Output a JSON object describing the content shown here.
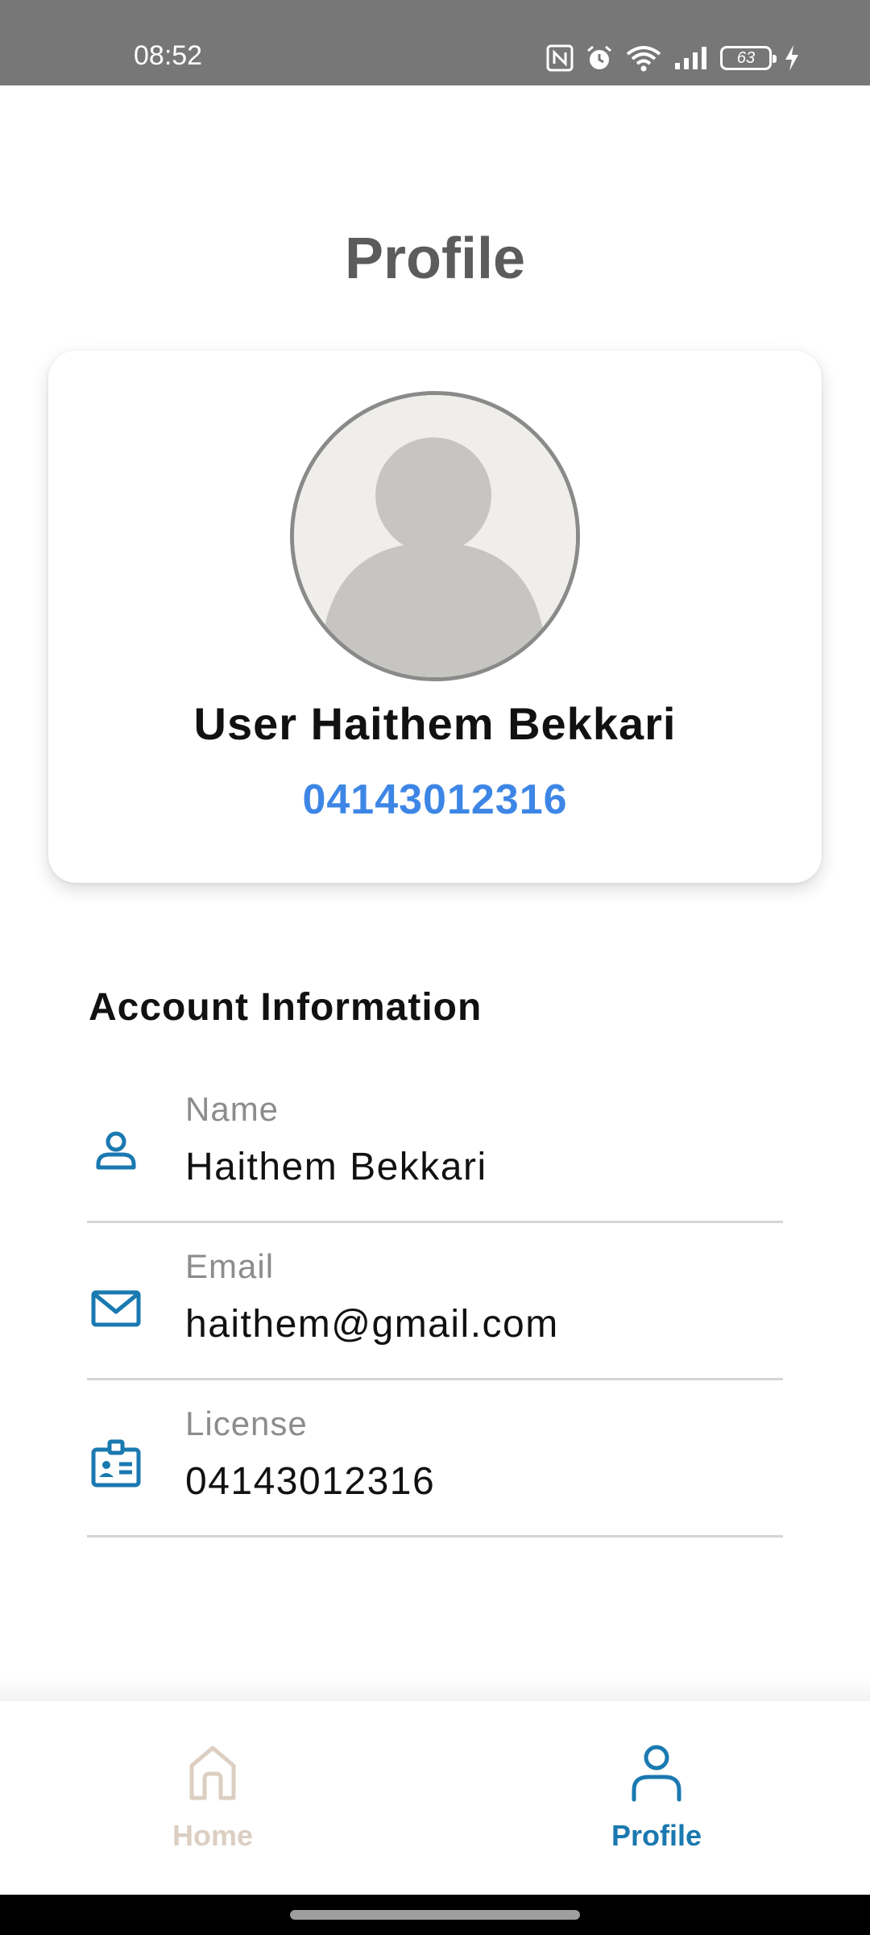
{
  "status_bar": {
    "time": "08:52",
    "battery_level": "63",
    "icons": [
      "nfc-icon",
      "alarm-icon",
      "wifi-icon",
      "signal-icon",
      "battery-icon",
      "charging-icon"
    ]
  },
  "page": {
    "title": "Profile"
  },
  "profile_card": {
    "avatar_icon": "default-avatar-icon",
    "name": "User Haithem Bekkari",
    "phone": "04143012316"
  },
  "account_info": {
    "section_title": "Account Information",
    "rows": [
      {
        "icon": "person-icon",
        "label": "Name",
        "value": "Haithem Bekkari"
      },
      {
        "icon": "mail-icon",
        "label": "Email",
        "value": "haithem@gmail.com"
      },
      {
        "icon": "id-badge-icon",
        "label": "License",
        "value": "04143012316"
      }
    ]
  },
  "bottom_nav": {
    "items": [
      {
        "icon": "home-icon",
        "label": "Home",
        "active": false
      },
      {
        "icon": "person-icon",
        "label": "Profile",
        "active": true
      }
    ]
  },
  "colors": {
    "accent": "#1a79b0",
    "phone_link": "#3d86e6",
    "title": "#5c5c5c",
    "inactive_nav": "#dccfc2",
    "status_bar": "#777777"
  }
}
